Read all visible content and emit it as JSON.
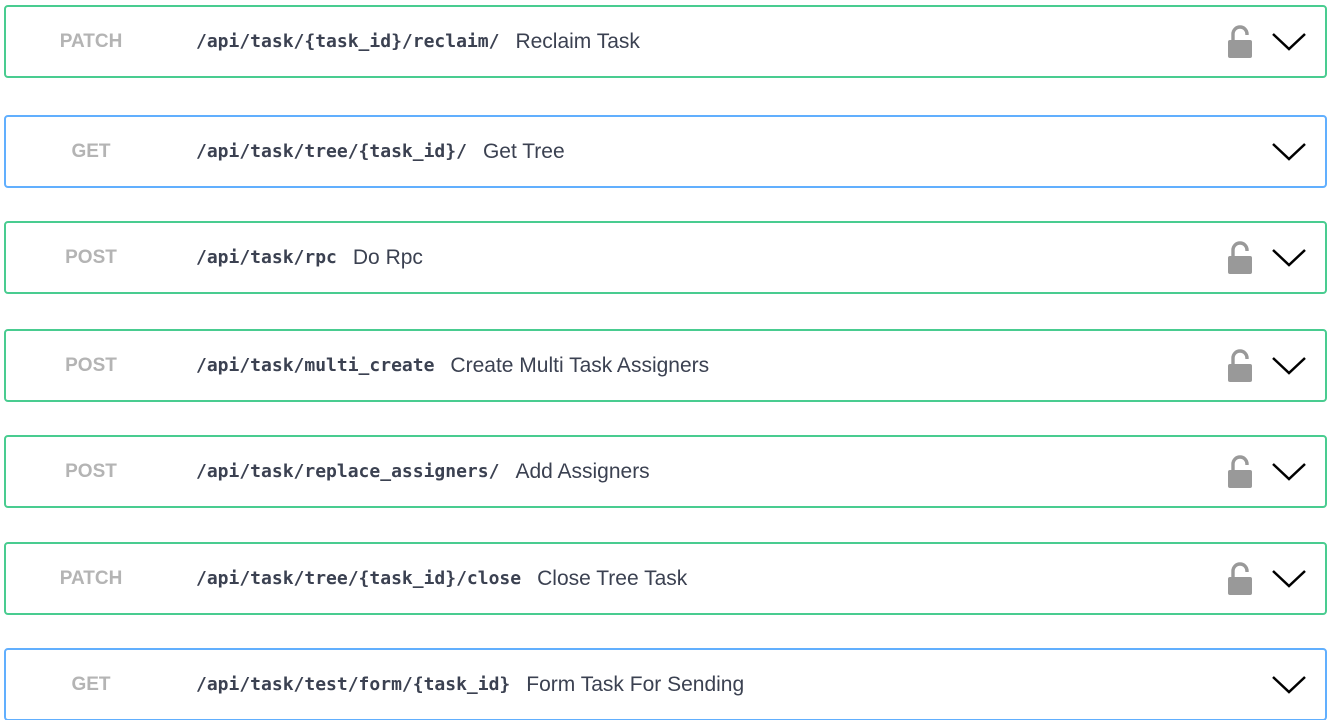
{
  "operations": [
    {
      "method": "PATCH",
      "path": "/api/task/{task_id}/reclaim/",
      "summary": "Reclaim Task",
      "color": "green",
      "locked": true
    },
    {
      "method": "GET",
      "path": "/api/task/tree/{task_id}/",
      "summary": "Get Tree",
      "color": "blue",
      "locked": false
    },
    {
      "method": "POST",
      "path": "/api/task/rpc",
      "summary": "Do Rpc",
      "color": "green",
      "locked": true
    },
    {
      "method": "POST",
      "path": "/api/task/multi_create",
      "summary": "Create Multi Task Assigners",
      "color": "green",
      "locked": true
    },
    {
      "method": "POST",
      "path": "/api/task/replace_assigners/",
      "summary": "Add Assigners",
      "color": "green",
      "locked": true
    },
    {
      "method": "PATCH",
      "path": "/api/task/tree/{task_id}/close",
      "summary": "Close Tree Task",
      "color": "green",
      "locked": true
    },
    {
      "method": "GET",
      "path": "/api/task/test/form/{task_id}",
      "summary": "Form Task For Sending",
      "color": "blue",
      "locked": false
    }
  ],
  "icons": {
    "lock": "unlock-icon",
    "expand": "chevron-down-icon"
  },
  "colors": {
    "green_border": "#49cc90",
    "blue_border": "#61affe",
    "method_text": "#b4b4b4",
    "text": "#3b4151"
  }
}
